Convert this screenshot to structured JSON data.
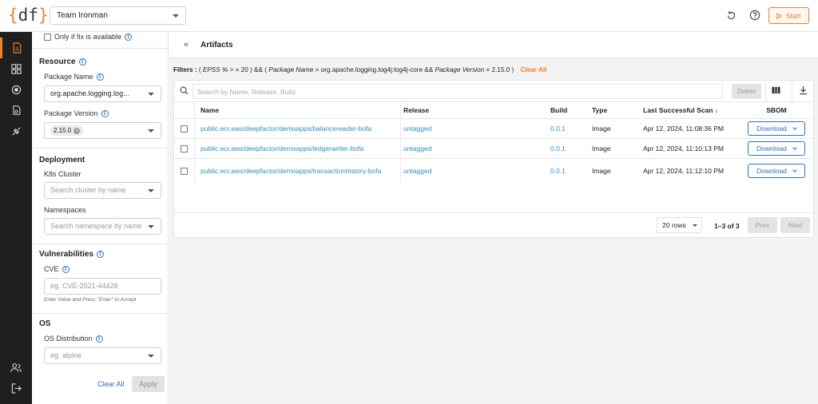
{
  "brand": {
    "open": "{",
    "name": "df",
    "close": "}"
  },
  "team": {
    "selected": "Team Ironman"
  },
  "header": {
    "start_label": "Start"
  },
  "filters": {
    "only_fix": "Only if fix is available",
    "resource": {
      "title": "Resource",
      "package_name_label": "Package Name",
      "package_name_value": "org.apache.logging.log...",
      "package_version_label": "Package Version",
      "package_version_chip": "2.15.0"
    },
    "deployment": {
      "title": "Deployment",
      "k8s_label": "K8s Cluster",
      "k8s_placeholder": "Search cluster by name",
      "namespaces_label": "Namespaces",
      "namespaces_placeholder": "Search namespace by name"
    },
    "vulnerabilities": {
      "title": "Vulnerabilities",
      "cve_label": "CVE",
      "cve_placeholder": "eg. CVE-2021-44428",
      "cve_hint": "Enter Value and Press \"Enter\" to Accept"
    },
    "os": {
      "title": "OS",
      "dist_label": "OS Distribution",
      "dist_placeholder": "eg. alpine"
    },
    "clear_all": "Clear All",
    "apply": "Apply"
  },
  "main": {
    "title": "Artifacts",
    "filter_summary": {
      "label": "Filters :",
      "p1": "(",
      "epss": "EPSS %",
      "p2": "> = 20 ) && (",
      "pkg_name": "Package Name",
      "p3": "= org.apache.logging.log4j:log4j-core &&",
      "pkg_version": "Package Version",
      "p4": "= 2.15.0 )",
      "clear": "Clear All"
    },
    "search_placeholder": "Search by Name, Release, Build",
    "delete_label": "Delete",
    "columns": {
      "name": "Name",
      "release": "Release",
      "build": "Build",
      "type": "Type",
      "scan": "Last Successful Scan",
      "sort_arrow": "↓",
      "sbom": "SBOM"
    },
    "rows": [
      {
        "name": "public.ecr.aws/deepfactor/demoapps/balancereader-bofa",
        "release": "untagged",
        "build": "0.0.1",
        "type": "Image",
        "scan": "Apr 12, 2024, 11:08:36 PM",
        "sbom": "Download"
      },
      {
        "name": "public.ecr.aws/deepfactor/demoapps/ledgerwriter-bofa",
        "release": "untagged",
        "build": "0.0.1",
        "type": "Image",
        "scan": "Apr 12, 2024, 11:10:13 PM",
        "sbom": "Download"
      },
      {
        "name": "public.ecr.aws/deepfactor/demoapps/transactionhistory-bofa",
        "release": "untagged",
        "build": "0.0.1",
        "type": "Image",
        "scan": "Apr 12, 2024, 11:12:10 PM",
        "sbom": "Download"
      }
    ],
    "pager": {
      "rows": "20 rows",
      "range": "1–3 of 3",
      "prev": "Prev",
      "next": "Next"
    }
  },
  "colors": {
    "accent": "#f07f27",
    "link": "#2f8fc4",
    "primary": "#2f6fbf",
    "rail": "#1f1f1f"
  }
}
